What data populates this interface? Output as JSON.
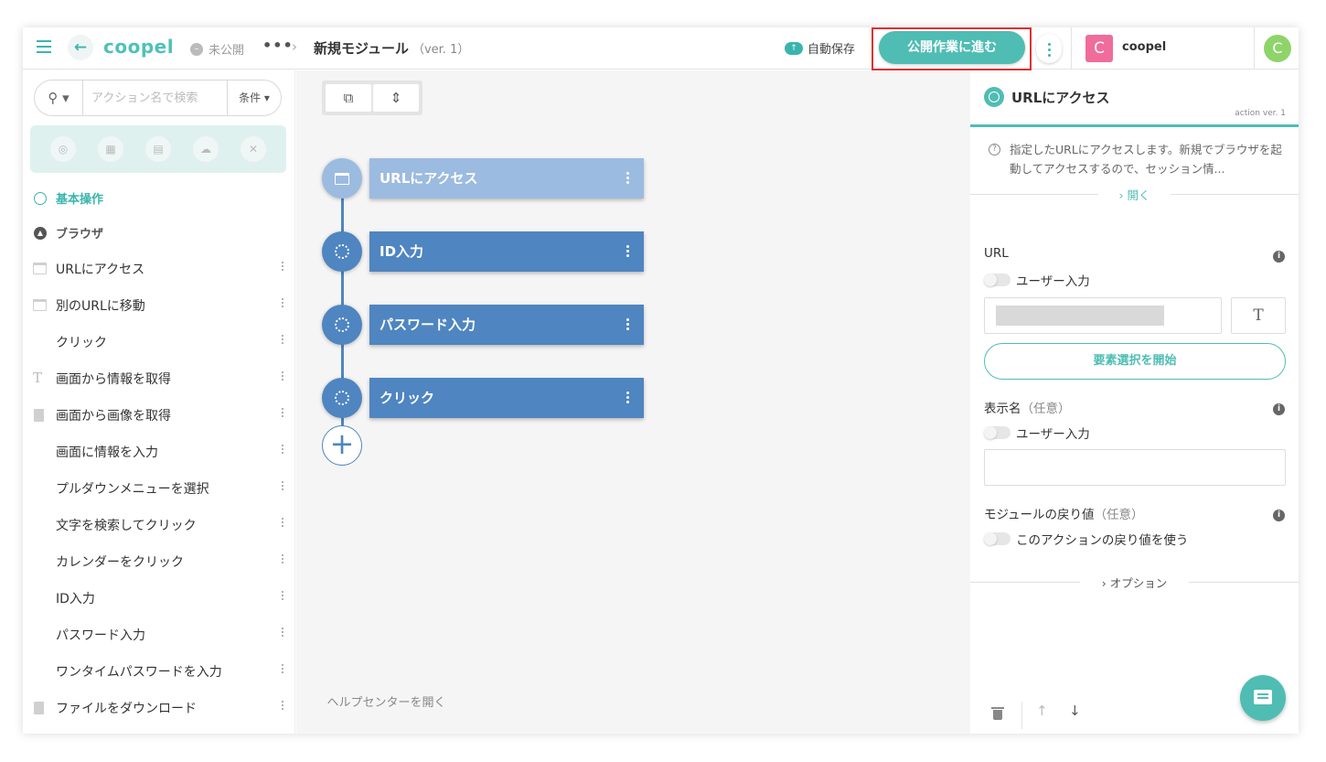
{
  "header": {
    "logo": "coopel",
    "status": "未公開",
    "more": "•••",
    "title": "新規モジュール",
    "version": "（ver. 1）",
    "autosave": "自動保存",
    "publish_label": "公開作業に進む",
    "org_initial": "C",
    "org_name": "coopel",
    "user_initial": "C"
  },
  "sidebar": {
    "search_placeholder": "アクション名で検索",
    "condition_label": "条件 ▾",
    "section_basic": "基本操作",
    "section_browser": "ブラウザ",
    "actions": [
      {
        "label": "URLにアクセス",
        "icon": "window-icon"
      },
      {
        "label": "別のURLに移動",
        "icon": "window-icon"
      },
      {
        "label": "クリック",
        "icon": ""
      },
      {
        "label": "画面から情報を取得",
        "icon": "text-icon"
      },
      {
        "label": "画面から画像を取得",
        "icon": "document-icon"
      },
      {
        "label": "画面に情報を入力",
        "icon": ""
      },
      {
        "label": "プルダウンメニューを選択",
        "icon": ""
      },
      {
        "label": "文字を検索してクリック",
        "icon": ""
      },
      {
        "label": "カレンダーをクリック",
        "icon": ""
      },
      {
        "label": "ID入力",
        "icon": ""
      },
      {
        "label": "パスワード入力",
        "icon": ""
      },
      {
        "label": "ワンタイムパスワードを入力",
        "icon": ""
      },
      {
        "label": "ファイルをダウンロード",
        "icon": "document-icon"
      }
    ]
  },
  "canvas": {
    "nodes": [
      {
        "label": "URLにアクセス",
        "state": "selected"
      },
      {
        "label": "ID入力",
        "state": "normal"
      },
      {
        "label": "パスワード入力",
        "state": "normal"
      },
      {
        "label": "クリック",
        "state": "normal"
      }
    ],
    "help_link": "ヘルプセンターを開く"
  },
  "panel": {
    "title": "URLにアクセス",
    "action_version": "action ver. 1",
    "description": "指定したURLにアクセスします。新規でブラウザを起動してアクセスするので、セッション情...",
    "open_label": "› 開く",
    "url_label": "URL",
    "user_input_label": "ユーザー入力",
    "select_element_label": "要素選択を開始",
    "display_name_label": "表示名",
    "optional": "（任意）",
    "return_label": "モジュールの戻り値",
    "use_return_label": "このアクションの戻り値を使う",
    "options_label": "› オプション",
    "t_button": "T"
  },
  "colors": {
    "accent": "#4fbdb4",
    "node_blue": "#4f85c0",
    "node_selected": "#9cbbe0",
    "highlight_border": "#e03030"
  }
}
